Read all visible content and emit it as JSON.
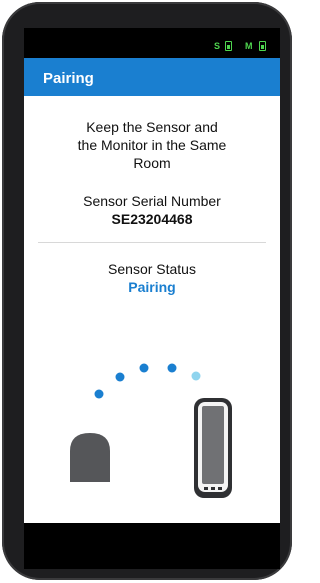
{
  "status_bar": {
    "left_indicator": "S",
    "right_indicator": "M",
    "accent_color": "#4fd64f"
  },
  "header": {
    "title": "Pairing",
    "background_color": "#1a7fd0"
  },
  "main": {
    "instruction": "Keep the Sensor and the Monitor in the Same Room",
    "serial_label": "Sensor Serial Number",
    "serial_value": "SE23204468",
    "status_label": "Sensor Status",
    "status_value": "Pairing",
    "status_color": "#1a7fd0"
  },
  "illustration": {
    "left_item": "sensor-icon",
    "right_item": "monitor-icon",
    "dot_colors": [
      "#1a7fd0",
      "#1a7fd0",
      "#1a7fd0",
      "#1a7fd0",
      "#8fd4ee"
    ]
  }
}
